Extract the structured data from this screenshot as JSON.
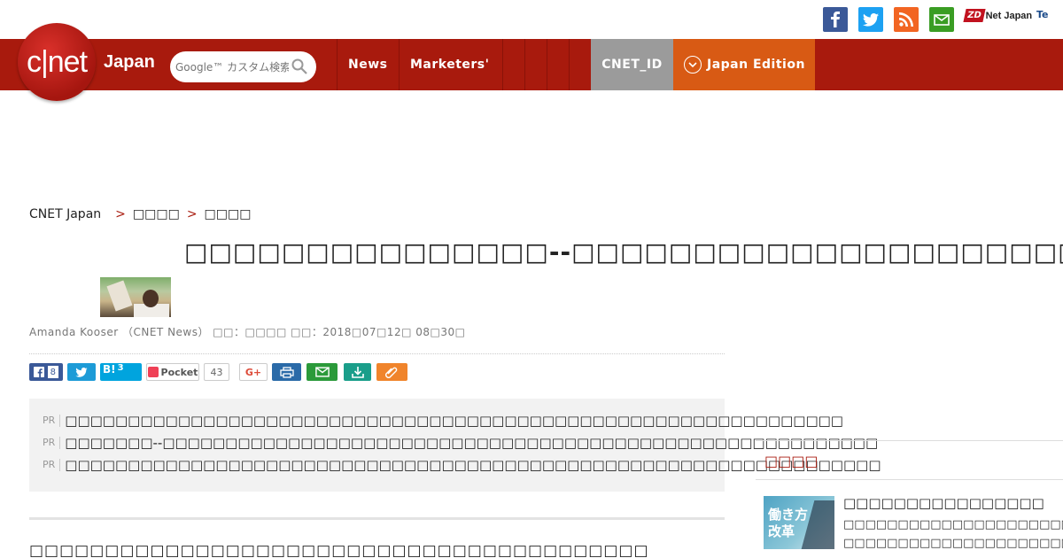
{
  "utility": {
    "zdnet_badge": "ZD",
    "zdnet_label": "Net Japan",
    "te_label": "Te",
    "social": [
      "facebook-icon",
      "twitter-icon",
      "rss-icon",
      "mail-icon"
    ]
  },
  "header": {
    "logo": "c|net",
    "logo_region": "Japan",
    "search_placeholder": "Google™ カスタム検索",
    "nav": [
      "News",
      "Marketers'"
    ],
    "cnet_id": "CNET_ID",
    "edition": "Japan Edition",
    "colors": {
      "header_bg": "#a81a0d",
      "edition_bg": "#d85a14",
      "cnetid_bg": "#9b9b9b"
    }
  },
  "breadcrumb": {
    "items": [
      "CNET Japan",
      "□□□□",
      "□□□□"
    ],
    "separator": ">"
  },
  "article": {
    "title": "□□□□□□□□□□□□□□□--□□□□□□□□□□□□□□□□□□□□□",
    "byline": "Amanda Kooser （CNET News） □□：□□□□ □□：2018□07□12□ 08□30□"
  },
  "share": {
    "facebook_count": "8",
    "hatena_label": "B!",
    "hatena_count": "3",
    "pocket_label": "Pocket",
    "pocket_count": "43",
    "gplus_label": "G+"
  },
  "pr": {
    "tag": "PR",
    "items": [
      "□□□□□□□□□□□□□□□□□□□□□□□□□□□□□□□□□□□□□□□□□□□□□□□□□□□□□□□□□□□□□□",
      "□□□□□□□--□□□□□□□□□□□□□□□□□□□□□□□□□□□□□□□□□□□□□□□□□□□□□□□□□□□□□□□□□",
      "□□□□□□□□□□□□□□□□□□□□□□□□□□□□□□□□□□□□□□□□□□□□□□□□□□□□□□□□□□□□□□□□□"
    ]
  },
  "body_first_line": "□□□□□□□□□□□□□□□□□□□□□□□□□□□□□□□□□□□□□□□□□",
  "sidebar": {
    "heading": "□□□□",
    "feature_thumb_text": [
      "働き方",
      "改革"
    ],
    "feature_title": "□□□□□□□□□□□□□□□□",
    "feature_desc": [
      "□□□□□□□□□□□□□□□□□□□□□",
      "□□□□□□□□□□□□□□□□□□□□□"
    ]
  }
}
